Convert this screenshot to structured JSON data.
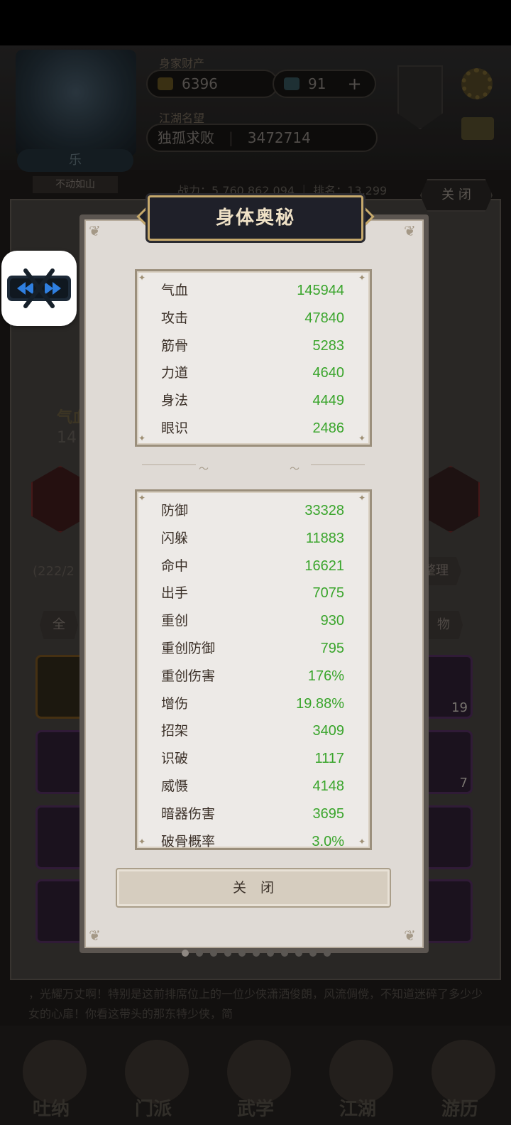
{
  "background": {
    "player": {
      "name": "乐",
      "status": "不动如山"
    },
    "wealth_label": "身家财产",
    "gold": "6396",
    "jade": "91",
    "reputation_label": "江湖名望",
    "rank_title": "独孤求败",
    "rank_value": "3472714",
    "combat_text": "战力：5,760,862,094 ｜ 排名：13,299",
    "close_label": "关 闭",
    "hp_label": "气血",
    "hp_partial": "14",
    "bag_count": "(222/2",
    "organize_label": "整理",
    "filter_all": "全",
    "filter_item": "物",
    "item_counts": [
      "19",
      "7"
    ],
    "dialog_text": "，光耀万丈啊！特别是这前排席位上的一位少侠潇洒俊朗，风流倜傥，不知道迷碎了多少少女的心扉！你看这带头的那东特少侠，简",
    "nav": [
      "吐纳",
      "门派",
      "武学",
      "江湖",
      "游历"
    ]
  },
  "modal": {
    "title": "身体奥秘",
    "primary_stats": [
      {
        "name": "气血",
        "value": "145944"
      },
      {
        "name": "攻击",
        "value": "47840"
      },
      {
        "name": "筋骨",
        "value": "5283"
      },
      {
        "name": "力道",
        "value": "4640"
      },
      {
        "name": "身法",
        "value": "4449"
      },
      {
        "name": "眼识",
        "value": "2486"
      }
    ],
    "secondary_stats": [
      {
        "name": "防御",
        "value": "33328"
      },
      {
        "name": "闪躲",
        "value": "11883"
      },
      {
        "name": "命中",
        "value": "16621"
      },
      {
        "name": "出手",
        "value": "7075"
      },
      {
        "name": "重创",
        "value": "930"
      },
      {
        "name": "重创防御",
        "value": "795"
      },
      {
        "name": "重创伤害",
        "value": "176%"
      },
      {
        "name": "增伤",
        "value": "19.88%"
      },
      {
        "name": "招架",
        "value": "3409"
      },
      {
        "name": "识破",
        "value": "1117"
      },
      {
        "name": "威慑",
        "value": "4148"
      },
      {
        "name": "暗器伤害",
        "value": "3695"
      },
      {
        "name": "破骨概率",
        "value": "3.0%"
      }
    ],
    "close_label": "关闭",
    "page_count": 11,
    "page_active": 0
  },
  "colors": {
    "stat_value": "#3aa52c",
    "title_text": "#efe1c6",
    "frame_gold": "#c6a96c"
  }
}
